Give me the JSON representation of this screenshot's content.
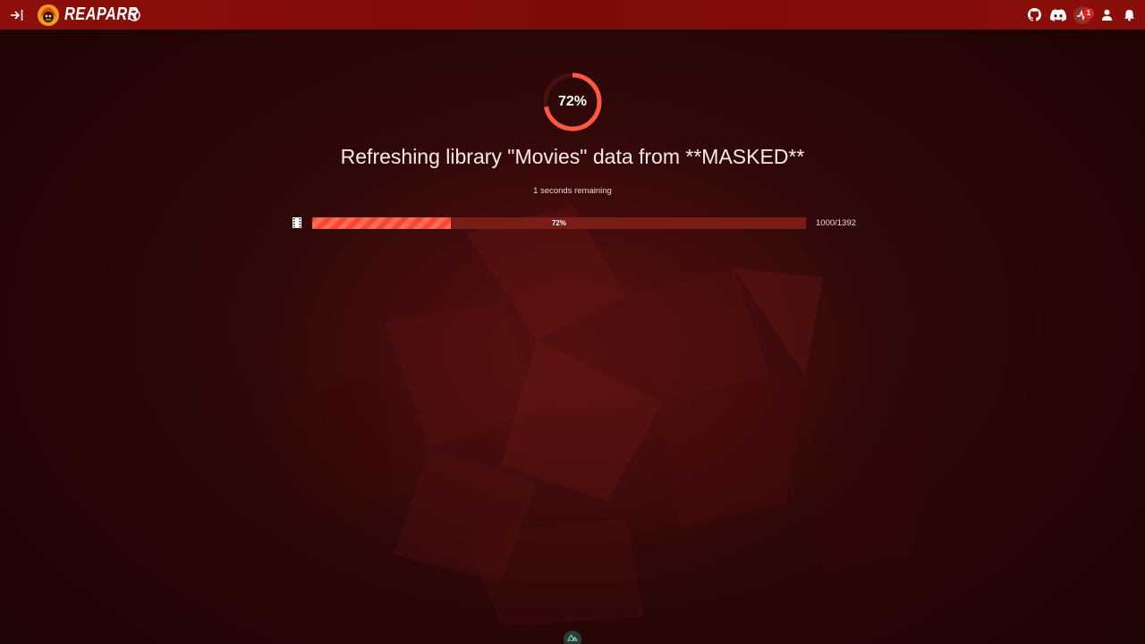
{
  "topbar": {
    "app_name": "REAPARR",
    "sidebar_toggle_icon": "sidebar-toggle-icon",
    "logo_icon": "reaper-logo-icon",
    "version_icon": "version-v-icon",
    "right_icons": [
      "github-icon",
      "discord-icon",
      "activity-icon",
      "user-icon",
      "bell-icon"
    ],
    "activity_badge": "1",
    "brand_color": "#8d0f0b"
  },
  "task": {
    "percent_label": "72%",
    "percent": 72,
    "title": "Refreshing library \"Movies\" data from **MASKED**",
    "time_remaining": "1 seconds remaining",
    "progress_label": "72%",
    "progress_fraction": 0.28,
    "count": "1000/1392",
    "item_icon": "film-icon",
    "accent_color": "#ff5a40"
  },
  "footer": {
    "icon": "nuxt-icon"
  }
}
